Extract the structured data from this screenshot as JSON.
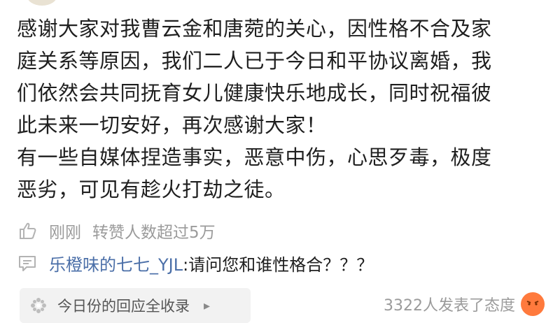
{
  "post": {
    "lines": [
      "感谢大家对我曹云金和唐菀的关心，因性格不合及家",
      "庭关系等原因，我们二人已于今日和平协议离婚，我",
      "们依然会共同抚育女儿健康快乐地成长，同时祝福彼",
      "此未来一切安好，再次感谢大家！",
      "有一些自媒体捏造事实，恶意中伤，心思歹毒，极度",
      "恶劣，可见有趁火打劫之徒。"
    ]
  },
  "meta": {
    "time": "刚刚",
    "reposts": "转赞人数超过5万",
    "like_icon": "thumbs-up-icon"
  },
  "comment": {
    "icon": "comment-icon",
    "user": "乐橙味的七七_YJL",
    "text": ":请问您和谁性格合？？？"
  },
  "response_card": {
    "icon": "flower-icon",
    "label": "今日份的回应全收录",
    "chevron_icon": "chevron-right-icon"
  },
  "attitude": {
    "text": "3322人发表了态度",
    "emoji": "angry-face-icon"
  },
  "colors": {
    "link_blue": "#4b6fa8",
    "meta_gray": "#9b9b9b",
    "angry_orange": "#ff7a3d"
  }
}
